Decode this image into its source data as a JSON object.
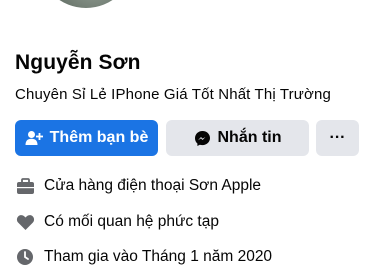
{
  "profile": {
    "name": "Nguyễn Sơn",
    "bio": "Chuyên Sỉ Lẻ IPhone Giá Tốt Nhất Thị Trường"
  },
  "actions": {
    "add_friend_label": "Thêm bạn bè",
    "message_label": "Nhắn tin",
    "more_label": "···"
  },
  "details": {
    "work": "Cửa hàng điện thoại Sơn Apple",
    "relationship": "Có mối quan hệ phức tạp",
    "joined": "Tham gia vào Tháng 1 năm 2020"
  },
  "colors": {
    "primary": "#1b74e4",
    "secondary_bg": "#e4e6eb",
    "icon_gray": "#65676b"
  }
}
